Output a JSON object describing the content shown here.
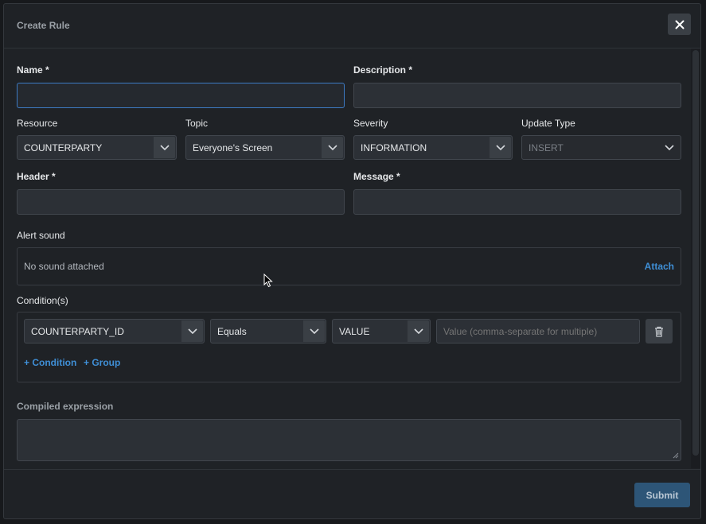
{
  "dialog": {
    "title": "Create Rule"
  },
  "form": {
    "name_label": "Name *",
    "name_value": "",
    "description_label": "Description *",
    "description_value": "",
    "resource_label": "Resource",
    "resource_value": "COUNTERPARTY",
    "topic_label": "Topic",
    "topic_value": "Everyone's Screen",
    "severity_label": "Severity",
    "severity_value": "INFORMATION",
    "update_type_label": "Update Type",
    "update_type_value": "INSERT",
    "header_label": "Header *",
    "header_value": "",
    "message_label": "Message *",
    "message_value": "",
    "alert_sound_label": "Alert sound",
    "no_sound_text": "No sound attached",
    "attach_label": "Attach",
    "conditions_label": "Condition(s)",
    "condition": {
      "field_value": "COUNTERPARTY_ID",
      "operator_value": "Equals",
      "type_value": "VALUE",
      "value_placeholder": "Value (comma-separate for multiple)"
    },
    "add_condition_label": "+ Condition",
    "add_group_label": "+ Group",
    "compiled_label": "Compiled expression",
    "compiled_value": ""
  },
  "footer": {
    "submit_label": "Submit"
  },
  "icons": {
    "close": "close-icon",
    "caret": "chevron-down-icon",
    "trash": "trash-icon"
  },
  "colors": {
    "accent": "#3f8fd6",
    "submit_bg": "#2d5577",
    "focus_border": "#3d7bc4"
  }
}
